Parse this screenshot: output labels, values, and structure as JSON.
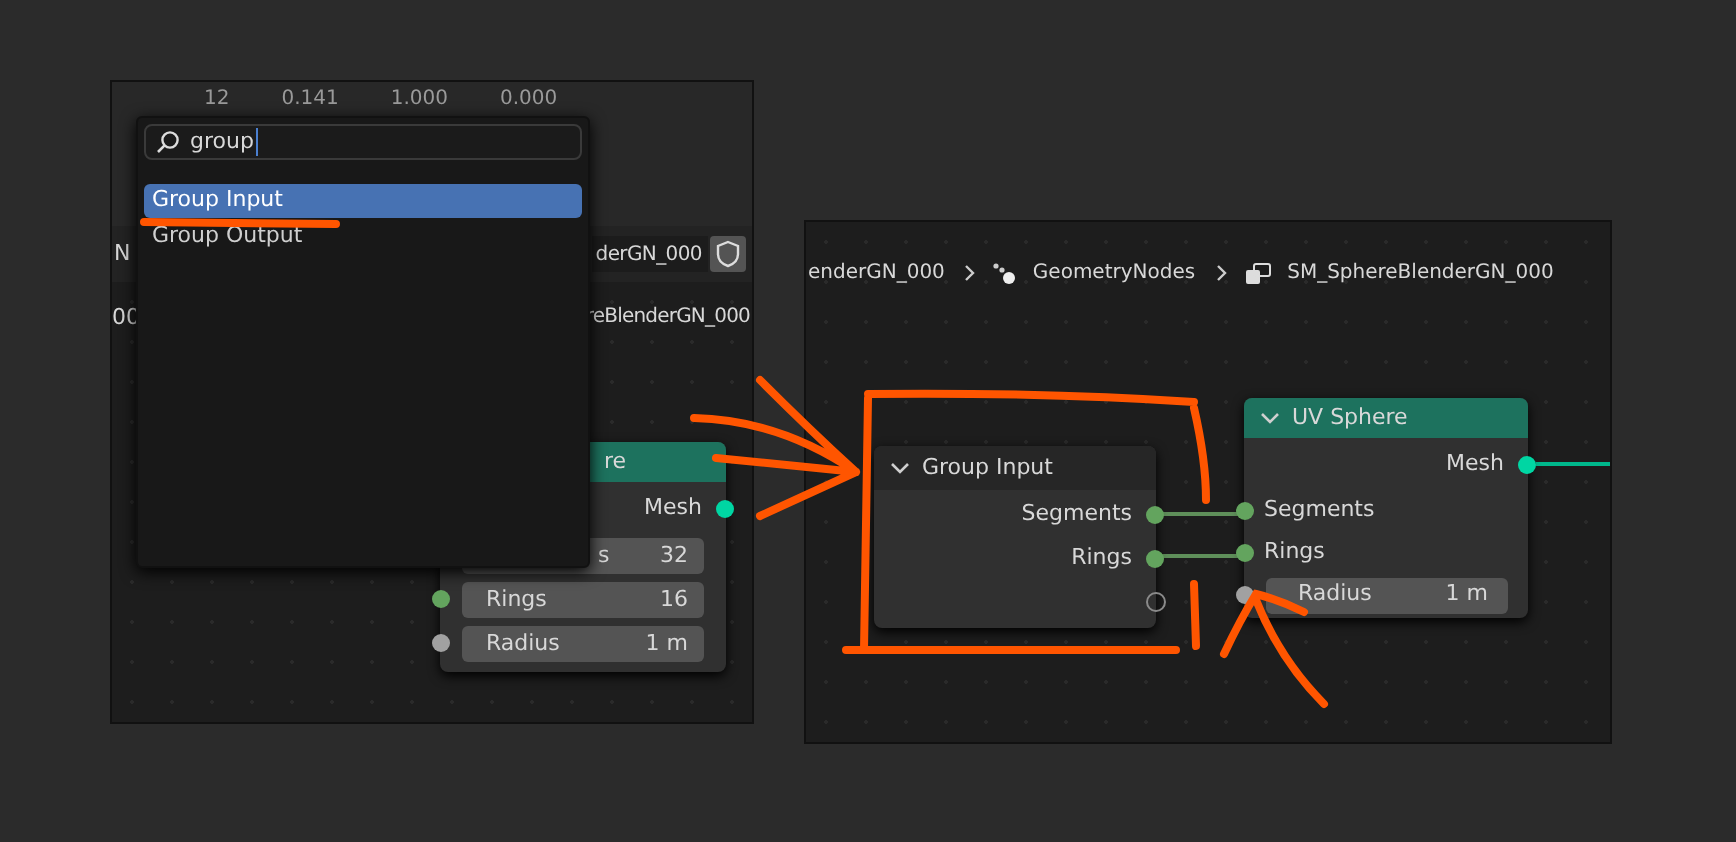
{
  "left_panel": {
    "table_row": [
      "12",
      "0.141",
      "1.000",
      "0.000"
    ],
    "header": {
      "left_text": "N",
      "name_field": "derGN_000"
    },
    "subheader": {
      "left_text": "00",
      "name": "reBlenderGN_000"
    },
    "search_popup": {
      "query": "group",
      "results": [
        {
          "label": "Group Input",
          "selected": true
        },
        {
          "label": "Group Output",
          "selected": false
        }
      ]
    },
    "node": {
      "title": "re",
      "outputs": [
        "Mesh"
      ],
      "fields": [
        {
          "label": "s",
          "value": "32"
        },
        {
          "label": "Rings",
          "value": "16",
          "color": "#63a45e"
        },
        {
          "label": "Radius",
          "value": "1 m",
          "color": "#a1a1a1"
        }
      ]
    }
  },
  "right_panel": {
    "breadcrumb": [
      {
        "kind": "text",
        "label": "enderGN_000"
      },
      {
        "kind": "nodes",
        "label": "GeometryNodes"
      },
      {
        "kind": "object",
        "label": "SM_SphereBlenderGN_000"
      }
    ],
    "group_input_node": {
      "title": "Group Input",
      "outputs": [
        "Segments",
        "Rings"
      ]
    },
    "uv_sphere_node": {
      "title": "UV Sphere",
      "outputs": [
        "Mesh"
      ],
      "inputs": [
        {
          "kind": "socket",
          "label": "Segments",
          "color": "#63a45e"
        },
        {
          "kind": "socket",
          "label": "Rings",
          "color": "#63a45e"
        },
        {
          "kind": "field",
          "label": "Radius",
          "value": "1 m",
          "color": "#a1a1a1"
        }
      ]
    }
  }
}
